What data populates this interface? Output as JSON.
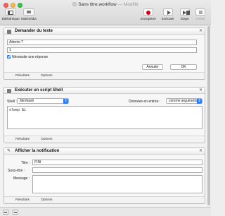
{
  "window": {
    "title": "Sans titre.workflow",
    "edited": " — Modifié"
  },
  "toolbar": {
    "library_label": "Bibliothèque",
    "media_label": "Multimédia",
    "record_label": "Enregistrer",
    "run_label": "Exécuter",
    "step_label": "Étape",
    "stop_label": "Arrêter"
  },
  "actions": [
    {
      "title": "Demander du texte",
      "question_value": "Attente ?",
      "answer_value": "1",
      "require_answer_label": "Nécessite une réponse",
      "cancel_label": "Annuler",
      "ok_label": "OK",
      "results_label": "Résultats",
      "options_label": "Options"
    },
    {
      "title": "Exécuter un script Shell",
      "shell_label": "Shell :",
      "shell_value": "/bin/bash",
      "input_label": "Données en entrée :",
      "input_value": "comme arguments",
      "script": "sleep $1",
      "results_label": "Résultats",
      "options_label": "Options"
    },
    {
      "title": "Afficher la notification",
      "title_label": "Titre :",
      "title_value": "FINI",
      "subtitle_label": "Sous-titre :",
      "subtitle_value": "",
      "message_label": "Message :",
      "message_value": "",
      "results_label": "Résultats",
      "options_label": "Options"
    }
  ]
}
